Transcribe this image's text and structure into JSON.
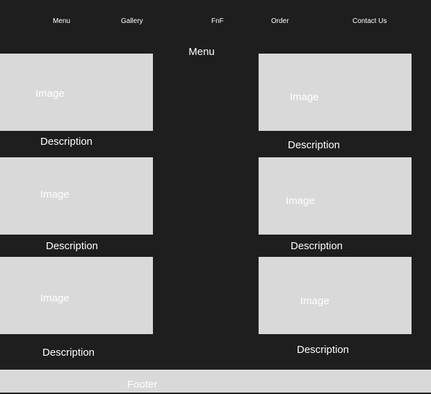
{
  "nav": {
    "menu": "Menu",
    "gallery": "Gallery",
    "fnf": "FnF",
    "order": "Order",
    "contact": "Contact Us"
  },
  "page": {
    "title": "Menu"
  },
  "cards": [
    {
      "image_label": "Image",
      "description": "Description"
    },
    {
      "image_label": "Image",
      "description": "Description"
    },
    {
      "image_label": "Image",
      "description": "Description"
    },
    {
      "image_label": "Image",
      "description": "Description"
    },
    {
      "image_label": "Image",
      "description": "Description"
    },
    {
      "image_label": "Image",
      "description": "Description"
    }
  ],
  "footer": {
    "label": "Footer"
  },
  "colors": {
    "background": "#1e1e1e",
    "placeholder": "#d9d9d9",
    "text": "#ffffff"
  }
}
